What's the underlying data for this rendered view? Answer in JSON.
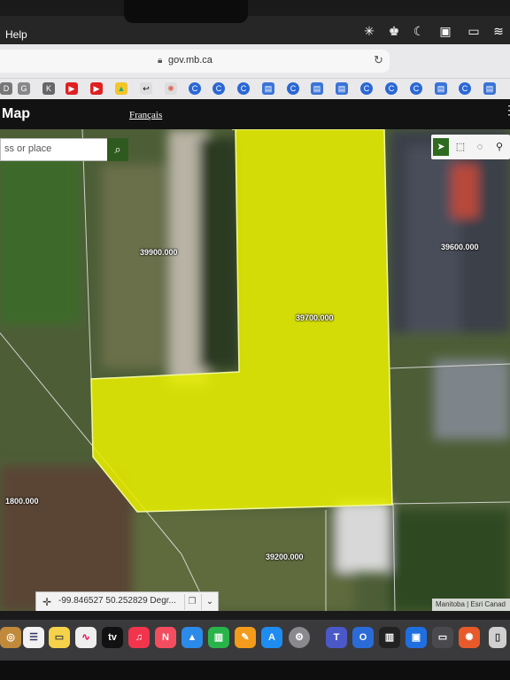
{
  "menubar": {
    "help": "Help"
  },
  "browser": {
    "url": "gov.mb.ca"
  },
  "app": {
    "title": "Map",
    "language_link": "Français"
  },
  "search": {
    "placeholder": "ss or place"
  },
  "parcels": {
    "main": "39700.000",
    "north_west": "39900.000",
    "north_east": "39600.000",
    "west": "1800.000",
    "south": "39200.000"
  },
  "coordinates": {
    "value": "-99.846527 50.252829 Degr..."
  },
  "attribution": "Manitoba | Esri Canad",
  "colors": {
    "selection": "#e6ee00",
    "header": "#121212",
    "search_button": "#2f5a1f"
  }
}
